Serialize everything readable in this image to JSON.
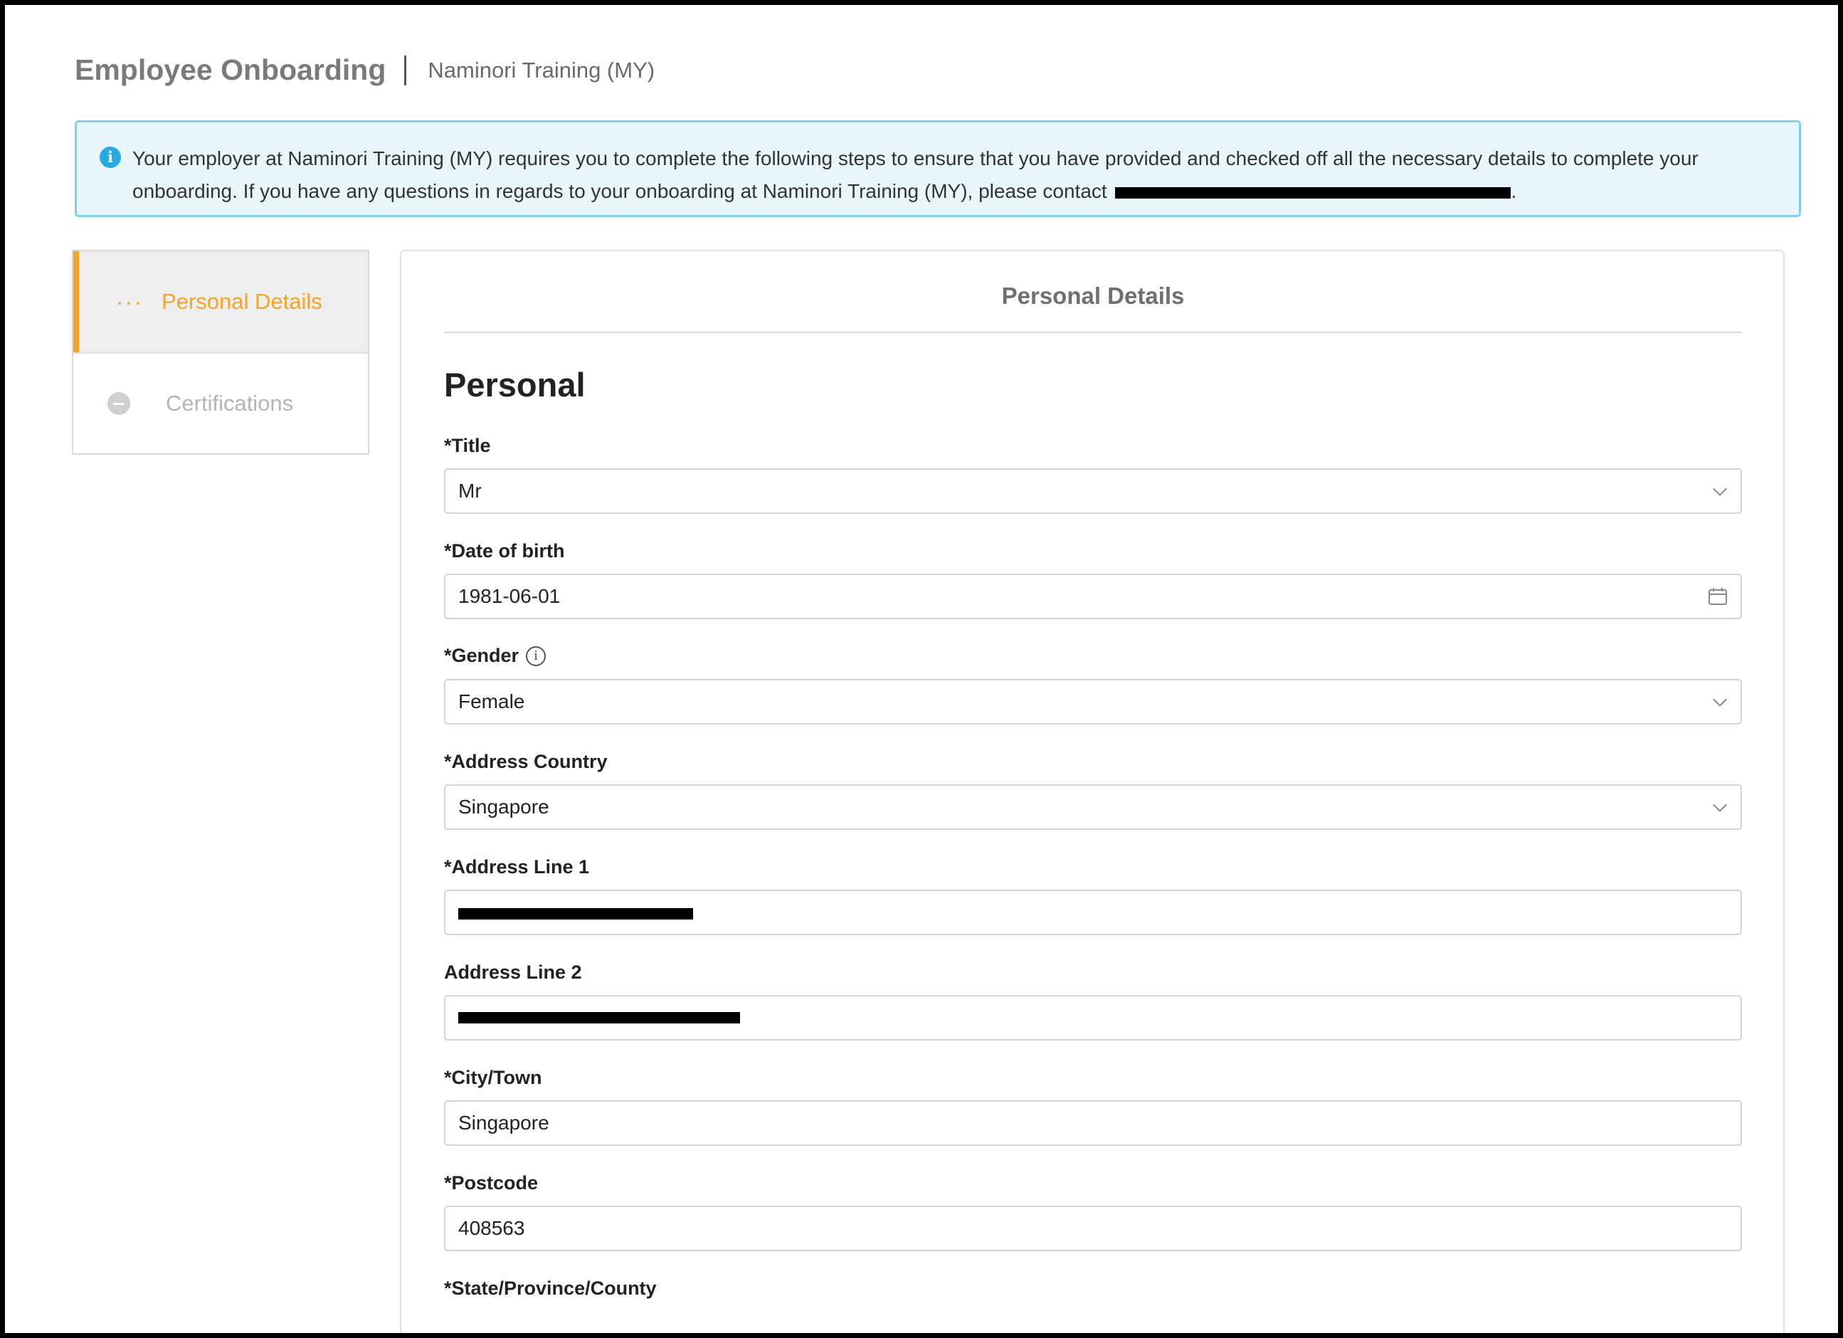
{
  "header": {
    "app_title": "Employee Onboarding",
    "org_name": "Naminori Training (MY)"
  },
  "banner": {
    "icon": "info-icon",
    "text": "Your employer at Naminori Training (MY) requires you to complete the following steps to ensure that you have provided and checked off all the necessary details to complete your onboarding. If you have any questions in regards to your onboarding at Naminori Training (MY), please contact",
    "end": "."
  },
  "sidebar": {
    "items": [
      {
        "label": "Personal Details",
        "icon": "ellipsis-icon",
        "state": "active",
        "icon_glyph": "···"
      },
      {
        "label": "Certifications",
        "icon": "minus-circle-icon",
        "state": "inactive"
      }
    ]
  },
  "card": {
    "title": "Personal Details",
    "section": "Personal",
    "fields": {
      "title": {
        "label": "*Title",
        "value": "Mr"
      },
      "dob": {
        "label": "*Date of birth",
        "value": "1981-06-01"
      },
      "gender": {
        "label": "*Gender",
        "value": "Female"
      },
      "country": {
        "label": "*Address Country",
        "value": "Singapore"
      },
      "address1": {
        "label": "*Address Line 1",
        "value": ""
      },
      "address2": {
        "label": "Address Line 2",
        "value": ""
      },
      "city": {
        "label": "*City/Town",
        "value": "Singapore"
      },
      "postcode": {
        "label": "*Postcode",
        "value": "408563"
      },
      "state": {
        "label": "*State/Province/County"
      }
    }
  },
  "colors": {
    "accent": "#f7a325",
    "info": "#28a9e1",
    "banner_bg": "#e8f6fc"
  }
}
